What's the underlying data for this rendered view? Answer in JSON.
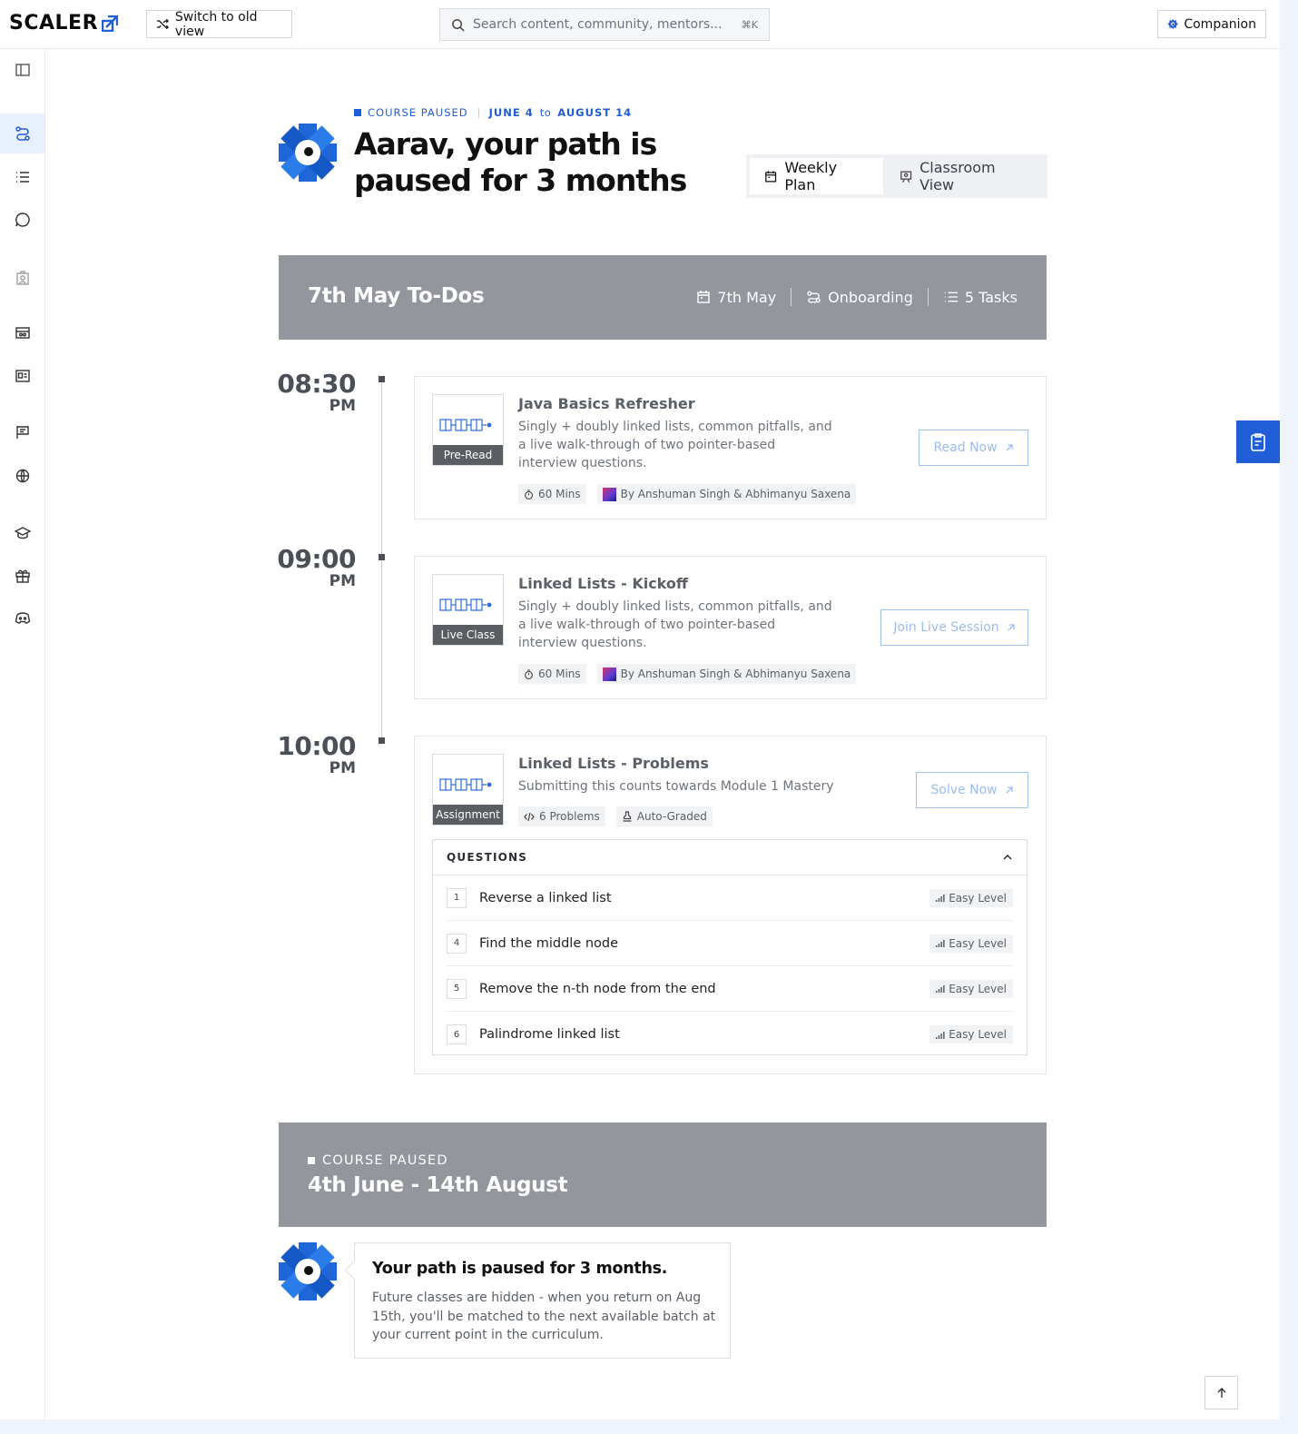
{
  "app": {
    "logo_text": "SCALER"
  },
  "topbar": {
    "switch_label": "Switch to old view",
    "search_placeholder": "Search content, community, mentors...",
    "search_shortcut": "⌘K",
    "companion_label": "Companion"
  },
  "sidebar": {
    "items": [
      {
        "name": "sidebar-toggle",
        "icon": "panel-icon"
      },
      {
        "name": "sidebar-item-path",
        "icon": "path-icon",
        "active": true
      },
      {
        "name": "sidebar-item-list",
        "icon": "list-icon"
      },
      {
        "name": "sidebar-item-chat",
        "icon": "chat-icon"
      },
      {
        "name": "sidebar-item-mentor",
        "icon": "mentor-icon"
      },
      {
        "name": "sidebar-item-card",
        "icon": "card-icon"
      },
      {
        "name": "sidebar-item-id",
        "icon": "id-card-icon"
      },
      {
        "name": "sidebar-item-board",
        "icon": "board-icon"
      },
      {
        "name": "sidebar-item-globe",
        "icon": "globe-icon"
      },
      {
        "name": "sidebar-item-courses",
        "icon": "graduation-cap-icon"
      },
      {
        "name": "sidebar-item-gifts",
        "icon": "gift-icon"
      },
      {
        "name": "sidebar-item-discord",
        "icon": "discord-icon"
      }
    ]
  },
  "header": {
    "status": "COURSE PAUSED",
    "date_from": "JUNE 4",
    "date_to_word": "to",
    "date_to": "AUGUST 14",
    "title": "Aarav, your path is paused for 3 months",
    "views": {
      "weekly": "Weekly Plan",
      "classroom": "Classroom View",
      "active": "weekly"
    }
  },
  "todo": {
    "title": "7th May To-Dos",
    "date": "7th May",
    "module": "Onboarding",
    "tasks": "5 Tasks"
  },
  "timeline": [
    {
      "time": "08:30",
      "ampm": "PM",
      "type": "Pre-Read",
      "title": "Java Basics Refresher",
      "desc": "Singly + doubly linked lists, common pitfalls, and a live walk-through of two pointer-based interview questions.",
      "duration": "60 Mins",
      "by": "By Anshuman Singh & Abhimanyu Saxena",
      "cta": "Read Now"
    },
    {
      "time": "09:00",
      "ampm": "PM",
      "type": "Live Class",
      "title": "Linked Lists - Kickoff",
      "desc": "Singly + doubly linked lists, common pitfalls, and a live walk-through of two pointer-based interview questions.",
      "duration": "60 Mins",
      "by": "By Anshuman Singh & Abhimanyu Saxena",
      "cta": "Join Live Session"
    },
    {
      "time": "10:00",
      "ampm": "PM",
      "type": "Assignment",
      "title": "Linked Lists - Problems",
      "desc": "Submitting this counts towards Module 1 Mastery",
      "problems": "6 Problems",
      "grading": "Auto-Graded",
      "cta": "Solve Now",
      "questions_label": "QUESTIONS",
      "questions": [
        {
          "num": "1",
          "title": "Reverse a linked list",
          "level": "Easy Level"
        },
        {
          "num": "4",
          "title": "Find the middle node",
          "level": "Easy Level"
        },
        {
          "num": "5",
          "title": "Remove the n-th node from the end",
          "level": "Easy Level"
        },
        {
          "num": "6",
          "title": "Palindrome linked list",
          "level": "Easy Level"
        }
      ]
    }
  ],
  "pause": {
    "label": "COURSE PAUSED",
    "dates": "4th June - 14th August",
    "message_title": "Your path is paused for 3 months.",
    "message_body": "Future classes are hidden - when you return on Aug 15th, you'll be matched to the next available batch at your current point in the curriculum."
  },
  "colors": {
    "accent": "#1f5ed6",
    "banner": "#93969c"
  }
}
